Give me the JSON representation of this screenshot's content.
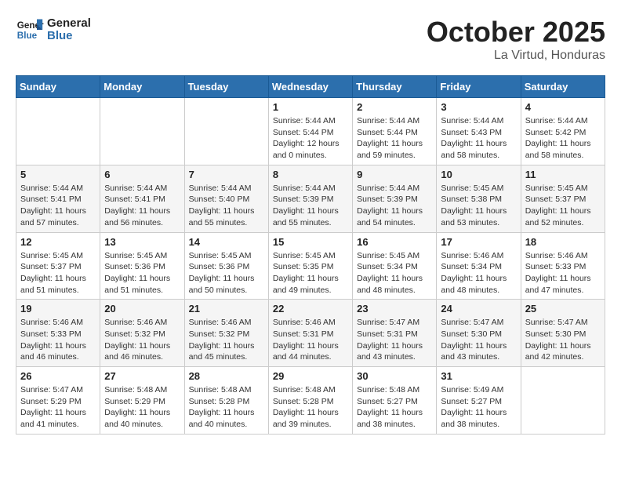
{
  "logo": {
    "line1": "General",
    "line2": "Blue"
  },
  "title": "October 2025",
  "subtitle": "La Virtud, Honduras",
  "days_of_week": [
    "Sunday",
    "Monday",
    "Tuesday",
    "Wednesday",
    "Thursday",
    "Friday",
    "Saturday"
  ],
  "weeks": [
    [
      {
        "day": "",
        "info": ""
      },
      {
        "day": "",
        "info": ""
      },
      {
        "day": "",
        "info": ""
      },
      {
        "day": "1",
        "info": "Sunrise: 5:44 AM\nSunset: 5:44 PM\nDaylight: 12 hours\nand 0 minutes."
      },
      {
        "day": "2",
        "info": "Sunrise: 5:44 AM\nSunset: 5:44 PM\nDaylight: 11 hours\nand 59 minutes."
      },
      {
        "day": "3",
        "info": "Sunrise: 5:44 AM\nSunset: 5:43 PM\nDaylight: 11 hours\nand 58 minutes."
      },
      {
        "day": "4",
        "info": "Sunrise: 5:44 AM\nSunset: 5:42 PM\nDaylight: 11 hours\nand 58 minutes."
      }
    ],
    [
      {
        "day": "5",
        "info": "Sunrise: 5:44 AM\nSunset: 5:41 PM\nDaylight: 11 hours\nand 57 minutes."
      },
      {
        "day": "6",
        "info": "Sunrise: 5:44 AM\nSunset: 5:41 PM\nDaylight: 11 hours\nand 56 minutes."
      },
      {
        "day": "7",
        "info": "Sunrise: 5:44 AM\nSunset: 5:40 PM\nDaylight: 11 hours\nand 55 minutes."
      },
      {
        "day": "8",
        "info": "Sunrise: 5:44 AM\nSunset: 5:39 PM\nDaylight: 11 hours\nand 55 minutes."
      },
      {
        "day": "9",
        "info": "Sunrise: 5:44 AM\nSunset: 5:39 PM\nDaylight: 11 hours\nand 54 minutes."
      },
      {
        "day": "10",
        "info": "Sunrise: 5:45 AM\nSunset: 5:38 PM\nDaylight: 11 hours\nand 53 minutes."
      },
      {
        "day": "11",
        "info": "Sunrise: 5:45 AM\nSunset: 5:37 PM\nDaylight: 11 hours\nand 52 minutes."
      }
    ],
    [
      {
        "day": "12",
        "info": "Sunrise: 5:45 AM\nSunset: 5:37 PM\nDaylight: 11 hours\nand 51 minutes."
      },
      {
        "day": "13",
        "info": "Sunrise: 5:45 AM\nSunset: 5:36 PM\nDaylight: 11 hours\nand 51 minutes."
      },
      {
        "day": "14",
        "info": "Sunrise: 5:45 AM\nSunset: 5:36 PM\nDaylight: 11 hours\nand 50 minutes."
      },
      {
        "day": "15",
        "info": "Sunrise: 5:45 AM\nSunset: 5:35 PM\nDaylight: 11 hours\nand 49 minutes."
      },
      {
        "day": "16",
        "info": "Sunrise: 5:45 AM\nSunset: 5:34 PM\nDaylight: 11 hours\nand 48 minutes."
      },
      {
        "day": "17",
        "info": "Sunrise: 5:46 AM\nSunset: 5:34 PM\nDaylight: 11 hours\nand 48 minutes."
      },
      {
        "day": "18",
        "info": "Sunrise: 5:46 AM\nSunset: 5:33 PM\nDaylight: 11 hours\nand 47 minutes."
      }
    ],
    [
      {
        "day": "19",
        "info": "Sunrise: 5:46 AM\nSunset: 5:33 PM\nDaylight: 11 hours\nand 46 minutes."
      },
      {
        "day": "20",
        "info": "Sunrise: 5:46 AM\nSunset: 5:32 PM\nDaylight: 11 hours\nand 46 minutes."
      },
      {
        "day": "21",
        "info": "Sunrise: 5:46 AM\nSunset: 5:32 PM\nDaylight: 11 hours\nand 45 minutes."
      },
      {
        "day": "22",
        "info": "Sunrise: 5:46 AM\nSunset: 5:31 PM\nDaylight: 11 hours\nand 44 minutes."
      },
      {
        "day": "23",
        "info": "Sunrise: 5:47 AM\nSunset: 5:31 PM\nDaylight: 11 hours\nand 43 minutes."
      },
      {
        "day": "24",
        "info": "Sunrise: 5:47 AM\nSunset: 5:30 PM\nDaylight: 11 hours\nand 43 minutes."
      },
      {
        "day": "25",
        "info": "Sunrise: 5:47 AM\nSunset: 5:30 PM\nDaylight: 11 hours\nand 42 minutes."
      }
    ],
    [
      {
        "day": "26",
        "info": "Sunrise: 5:47 AM\nSunset: 5:29 PM\nDaylight: 11 hours\nand 41 minutes."
      },
      {
        "day": "27",
        "info": "Sunrise: 5:48 AM\nSunset: 5:29 PM\nDaylight: 11 hours\nand 40 minutes."
      },
      {
        "day": "28",
        "info": "Sunrise: 5:48 AM\nSunset: 5:28 PM\nDaylight: 11 hours\nand 40 minutes."
      },
      {
        "day": "29",
        "info": "Sunrise: 5:48 AM\nSunset: 5:28 PM\nDaylight: 11 hours\nand 39 minutes."
      },
      {
        "day": "30",
        "info": "Sunrise: 5:48 AM\nSunset: 5:27 PM\nDaylight: 11 hours\nand 38 minutes."
      },
      {
        "day": "31",
        "info": "Sunrise: 5:49 AM\nSunset: 5:27 PM\nDaylight: 11 hours\nand 38 minutes."
      },
      {
        "day": "",
        "info": ""
      }
    ]
  ]
}
